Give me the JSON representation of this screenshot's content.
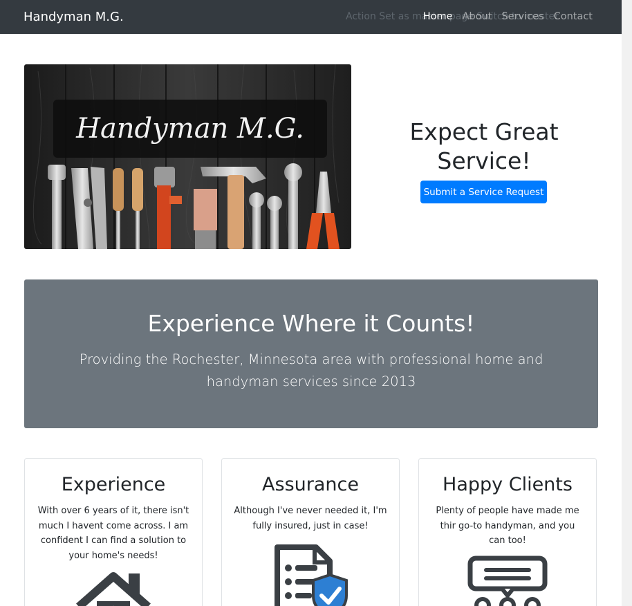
{
  "navbar": {
    "brand": "Handyman M.G.",
    "ghost_text": "Action Set as master page Switch to master",
    "items": [
      {
        "label": "Home",
        "active": true
      },
      {
        "label": "About",
        "active": false
      },
      {
        "label": "Services",
        "active": false
      },
      {
        "label": "Contact",
        "active": false
      }
    ]
  },
  "hero": {
    "image_logo_text": "Handyman M.G.",
    "title": "Expect Great Service!",
    "button_label": "Submit a Service Request"
  },
  "jumbotron": {
    "title": "Experience Where it Counts!",
    "subtitle": "Providing the Rochester, Minnesota area with professional home and handyman services since 2013"
  },
  "cards": [
    {
      "title": "Experience",
      "text": "With over 6 years of it, there isn't much I havent come across. I am confident I can find a solution to your home's needs!",
      "icon": "house-icon"
    },
    {
      "title": "Assurance",
      "text": "Although I've never needed it, I'm fully insured, just in case!",
      "icon": "insured-document-icon"
    },
    {
      "title": "Happy Clients",
      "text": "Plenty of people have made me thir go-to handyman, and you can too!",
      "icon": "reviews-icon"
    }
  ],
  "colors": {
    "navbar_bg": "#343a40",
    "primary": "#007bff",
    "jumbotron_bg": "#6c757d"
  }
}
